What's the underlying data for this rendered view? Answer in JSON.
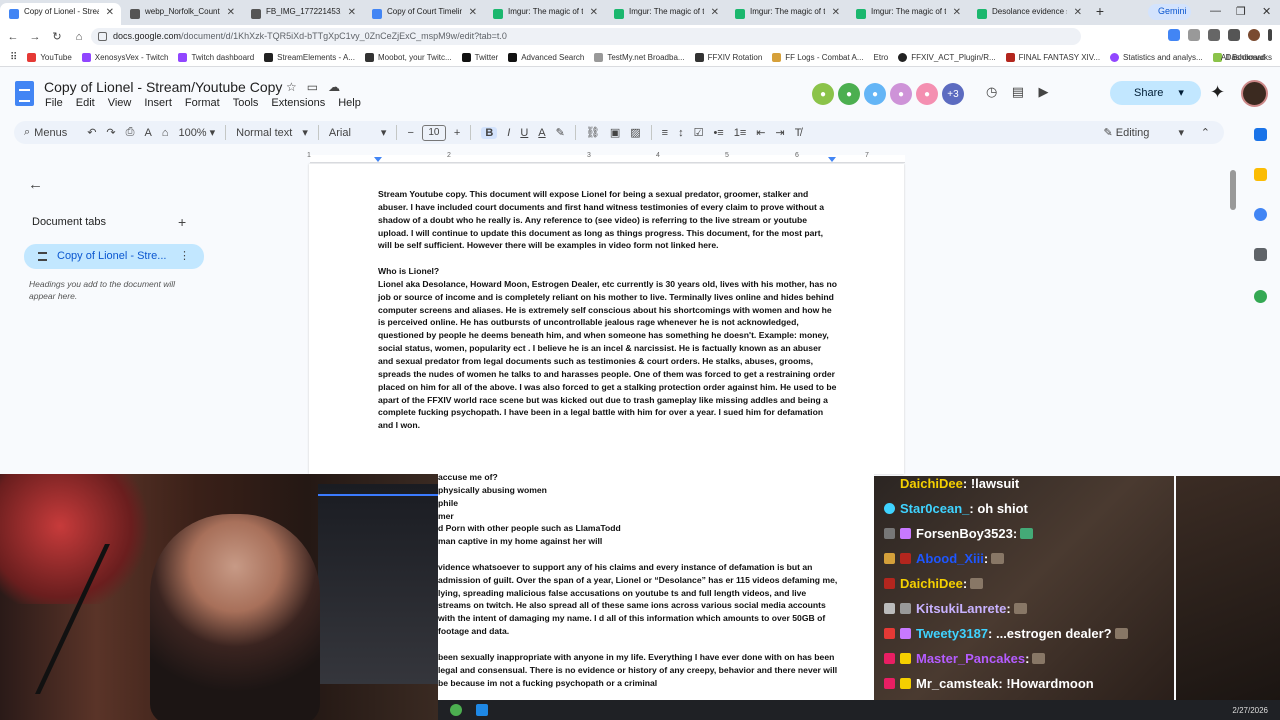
{
  "browser": {
    "tabs": [
      {
        "label": "Copy of Lionel - Stream/Y",
        "active": true,
        "icon": "docs-icon"
      },
      {
        "label": "webp_Norfolk_County_C",
        "active": false,
        "icon": "image-icon"
      },
      {
        "label": "FB_IMG_177221453141S",
        "active": false,
        "icon": "image-icon"
      },
      {
        "label": "Copy of Court Timeline",
        "active": false,
        "icon": "docs-icon"
      },
      {
        "label": "Imgur: The magic of the",
        "active": false,
        "icon": "imgur-icon"
      },
      {
        "label": "Imgur: The magic of the",
        "active": false,
        "icon": "imgur-icon"
      },
      {
        "label": "Imgur: The magic of the",
        "active": false,
        "icon": "imgur-icon"
      },
      {
        "label": "Imgur: The magic of the",
        "active": false,
        "icon": "imgur-icon"
      },
      {
        "label": "Desolance evidence shee",
        "active": false,
        "icon": "sheets-icon"
      }
    ],
    "gemini_label": "Gemini",
    "url_main": "docs.google.com",
    "url_rest": "/document/d/1KhXzk-TQR5iXd-bTTgXpC1vy_0ZnCeZjExC_mspM9w/edit?tab=t.0",
    "bookmarks": [
      "YouTube",
      "XenosysVex - Twitch",
      "Twitch dashboard",
      "StreamElements - A...",
      "Moobot, your Twitc...",
      "Twitter",
      "Advanced Search",
      "TestMy.net Broadba...",
      "FFXIV Rotation",
      "FF Logs - Combat A...",
      "Etro",
      "FFXIV_ACT_Plugin/R...",
      "FINAL FANTASY XIV...",
      "Statistics and analys...",
      "Dashboard"
    ],
    "all_bookmarks": "All Bookmarks"
  },
  "docs": {
    "title": "Copy of Lionel - Stream/Youtube Copy",
    "menu": [
      "File",
      "Edit",
      "View",
      "Insert",
      "Format",
      "Tools",
      "Extensions",
      "Help"
    ],
    "avatar_more": "+3",
    "share_label": "Share",
    "toolbar": {
      "menus": "Menus",
      "zoom": "100%",
      "style": "Normal text",
      "font": "Arial",
      "size": "10",
      "mode": "Editing"
    },
    "ruler": [
      "1",
      "2",
      "3",
      "4",
      "5",
      "6",
      "7"
    ],
    "sidebar": {
      "heading": "Document tabs",
      "tab_label": "Copy of Lionel - Stre...",
      "hint": "Headings you add to the document will appear here."
    },
    "content": {
      "intro": "Stream Youtube copy. This document will expose Lionel for being a sexual predator, groomer, stalker and abuser. I have included court documents and first hand witness testimonies of every claim to prove without a shadow of a doubt who he really is. Any reference to (see video) is referring to the live stream or youtube upload. I will continue to update this document as long as things progress. This document, for the most part, will be self sufficient. However there will be examples in video form not linked here.",
      "heading1": "Who is Lionel?",
      "para1": "Lionel aka Desolance, Howard Moon,  Estrogen Dealer, etc currently is 30 years old, lives with his mother, has no job or source of income and is completely reliant on his mother to live. Terminally lives online and hides behind computer screens and aliases. He is extremely self conscious about his shortcomings with women and how he is perceived online. He has outbursts of uncontrollable jealous rage whenever he is not acknowledged, questioned by people he deems beneath him, and when someone has something he doesn't. Example: money, social status, women, popularity ect . I believe he is an incel & narcissist. He is factually known as an abuser and sexual predator from legal documents such as testimonies & court orders. He stalks, abuses, grooms, spreads the nudes of women he talks to and harasses people. One of them was forced to get a restraining order placed on him for all of the above. I was also forced to get a stalking protection order against him. He used to be apart of the FFXIV world race scene but was kicked out due to trash gameplay like missing addles and being a complete fucking psychopath. I have been in a legal battle with him for over a year. I sued him for defamation and I won.",
      "bottom_heading": "accuse me of?",
      "bottom_items": [
        "physically abusing women",
        "phile",
        "mer",
        "d Porn with other people such as LlamaTodd",
        "man captive in my home against her will"
      ],
      "bottom_para1": "vidence whatsoever to support any of his claims and every instance of defamation is but an admission of guilt. Over the span of a year, Lionel or “Desolance” has er 115 videos defaming me, lying, spreading malicious false accusations on youtube ts and full length videos, and live streams on twitch. He also spread all of these same ions across various social media accounts with the intent of damaging my name. I d all of this information which amounts to over 50GB of footage and data.",
      "bottom_para2": "been sexually inappropriate with anyone in my life. Everything I have ever done with on has been legal and consensual. There is no evidence or history of any creepy, behavior and there never will be because im not a fucking psychopath or a criminal"
    }
  },
  "chat": [
    {
      "user": "DaichiDee",
      "msg": ": !lawsuit",
      "color": "#f5d000"
    },
    {
      "user": "Star0cean_",
      "msg": ": oh shiot",
      "color": "#3fd3ff"
    },
    {
      "user": "ForsenBoy3523",
      "msg": ":",
      "color": "#ffffff"
    },
    {
      "user": "Abood_Xiii",
      "msg": ":",
      "color": "#1e56ff"
    },
    {
      "user": "DaichiDee",
      "msg": ":",
      "color": "#f5d000"
    },
    {
      "user": "KitsukiLanrete",
      "msg": ":",
      "color": "#c8b2ff"
    },
    {
      "user": "Tweety3187",
      "msg": ": ...estrogen dealer?",
      "color": "#3fd3ff"
    },
    {
      "user": "Master_Pancakes",
      "msg": ":",
      "color": "#b45cff"
    },
    {
      "user": "Mr_camsteak",
      "msg": ": !Howardmoon",
      "color": "#ffffff"
    }
  ],
  "taskbar": {
    "date": "2/27/2026"
  },
  "colors": {
    "accent": "#0b57d0",
    "share_bg": "#c2e7ff",
    "toolbar_bg": "#edf2fa"
  }
}
